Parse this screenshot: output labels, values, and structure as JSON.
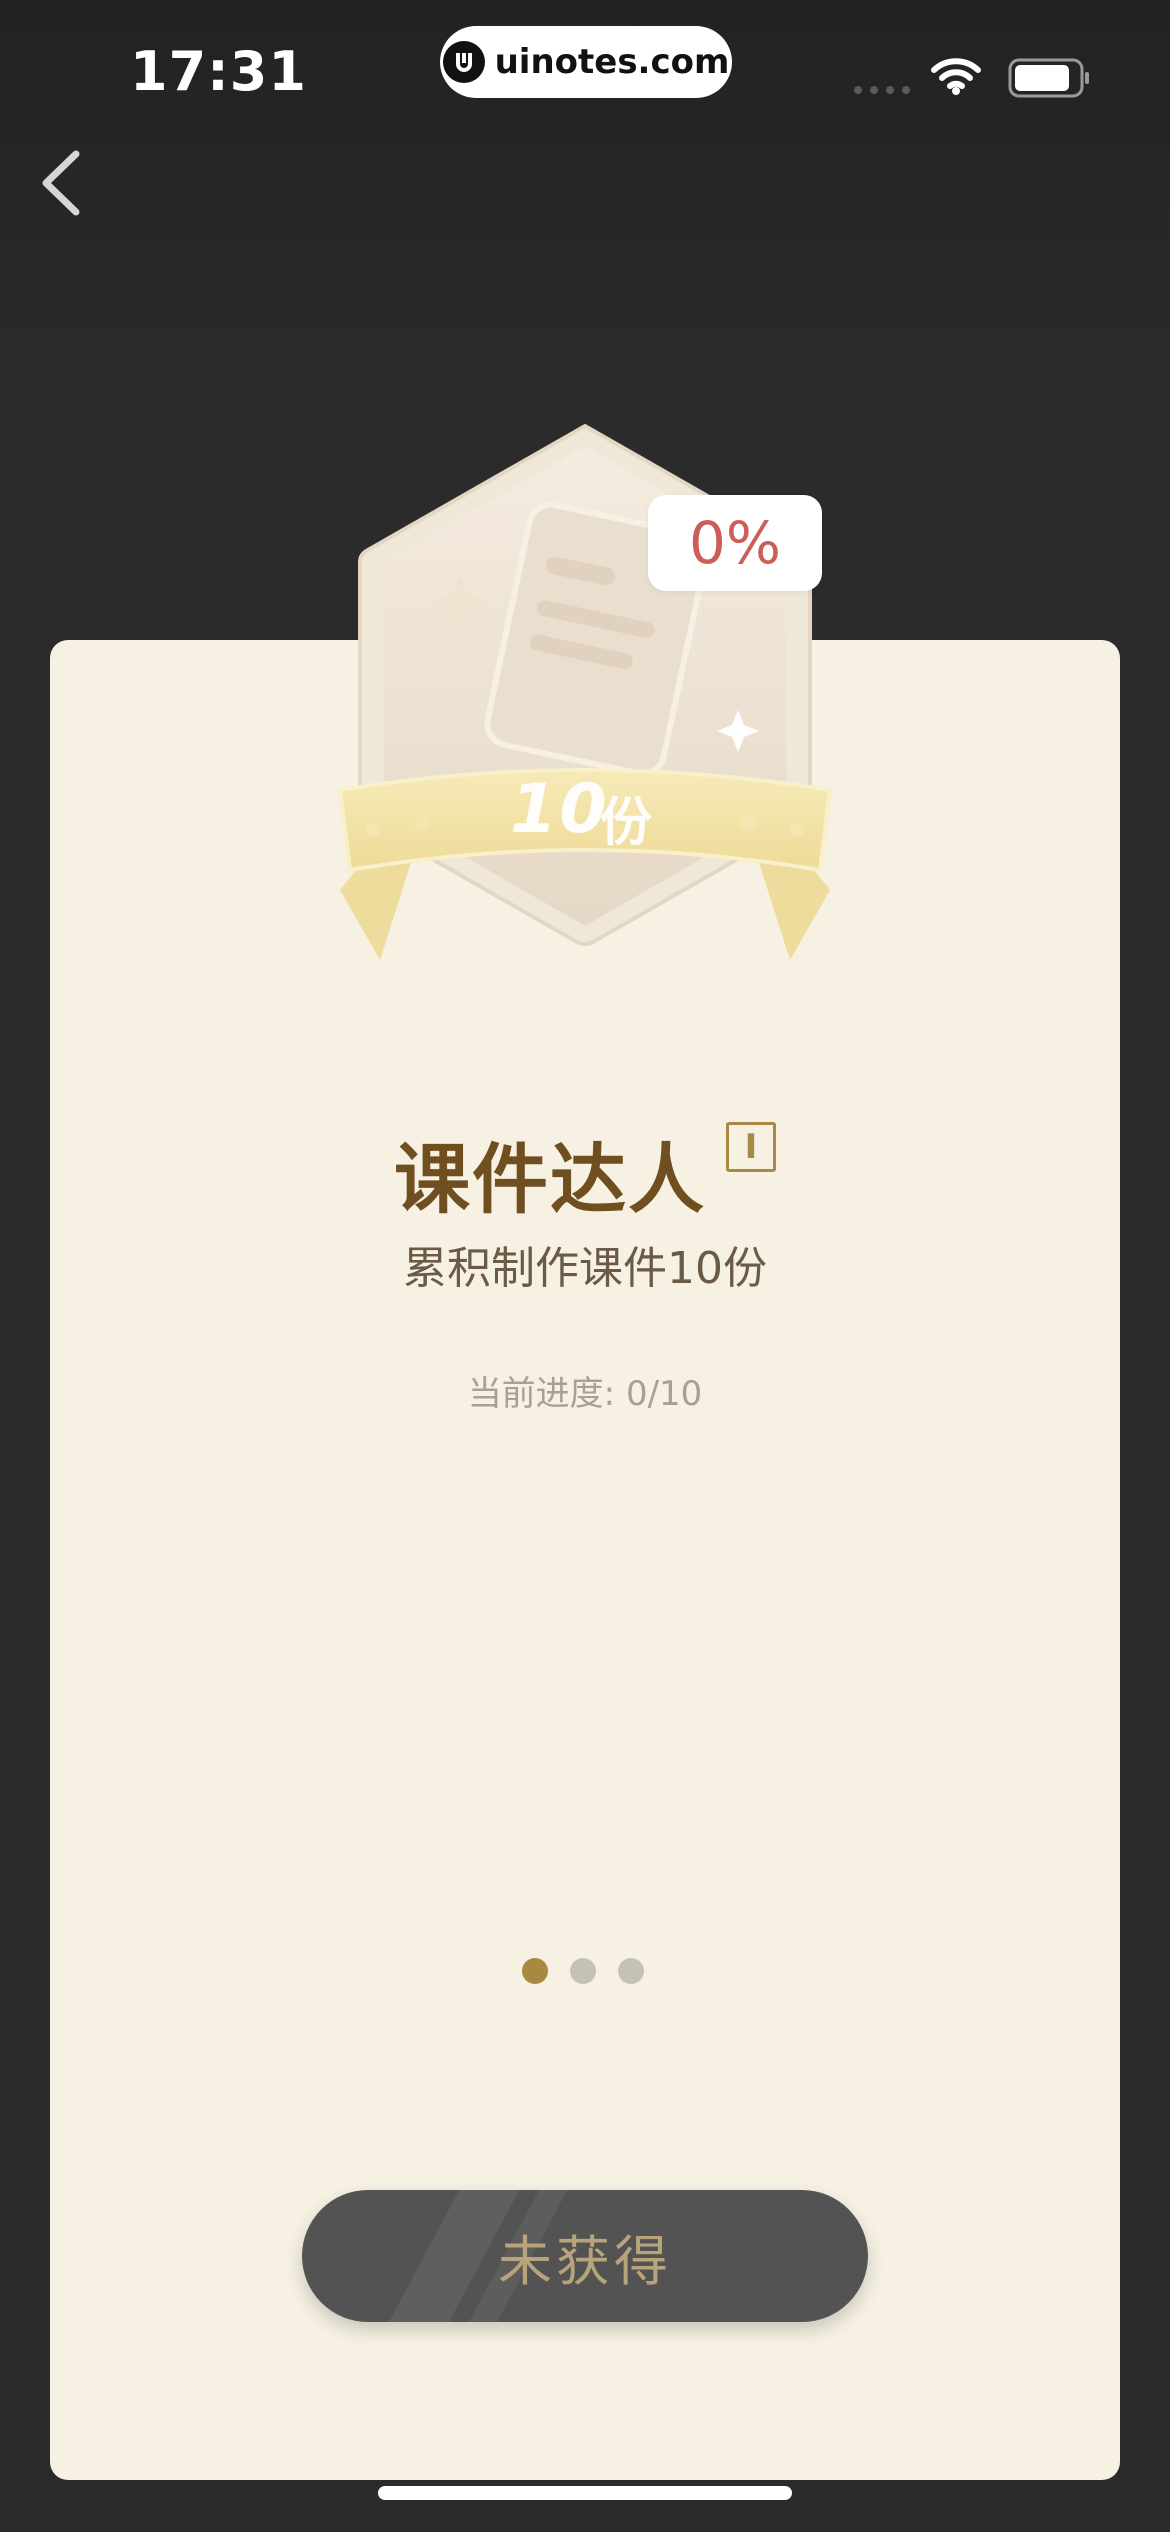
{
  "status_bar": {
    "time": "17:31",
    "url": "uinotes.com"
  },
  "badge": {
    "percent": "0%",
    "count_number": "10",
    "count_unit": "份"
  },
  "achievement": {
    "title": "课件达人",
    "level": "I",
    "description": "累积制作课件10份",
    "progress_text": "当前进度: 0/10",
    "progress_fraction": 0
  },
  "pager": {
    "pages": 3,
    "active_index": 0
  },
  "status_button": {
    "label": "未获得"
  },
  "colors": {
    "card_bg": "#f6f1e3",
    "title": "#6f4e1f",
    "percent": "#cc5d57",
    "accent_gold": "#a88941",
    "button_bg": "#545354"
  },
  "icons": {
    "back": "chevron-left-icon",
    "wifi": "wifi-icon",
    "battery": "battery-icon",
    "badge": "courseware-document-icon"
  }
}
